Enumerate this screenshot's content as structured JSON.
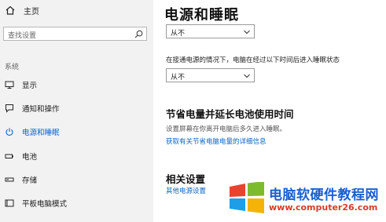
{
  "sidebar": {
    "home_label": "主页",
    "search_placeholder": "查找设置",
    "section_title": "系统",
    "items": [
      {
        "label": "显示"
      },
      {
        "label": "通知和操作"
      },
      {
        "label": "电源和睡眠"
      },
      {
        "label": "电池"
      },
      {
        "label": "存储"
      },
      {
        "label": "平板电脑模式"
      }
    ],
    "active_index": 2
  },
  "main": {
    "title": "电源和睡眠",
    "dropdown1_value": "从不",
    "sleep_desc": "在接通电源的情况下，电脑在经过以下时间后进入睡眠状态",
    "dropdown2_value": "从不",
    "battery_heading": "节省电量并延长电池使用时间",
    "battery_desc": "设置屏幕在你离开电脑后多久进入睡眠。",
    "battery_link": "获取有关节省电脑电量的详细信息",
    "related_heading": "相关设置",
    "related_link": "其他电源设置"
  },
  "watermark": {
    "title": "电脑软硬件教程网",
    "url": "www.computer26.com"
  },
  "colors": {
    "accent": "#0a64c8",
    "sidebar_bg": "#f2f2f2"
  }
}
